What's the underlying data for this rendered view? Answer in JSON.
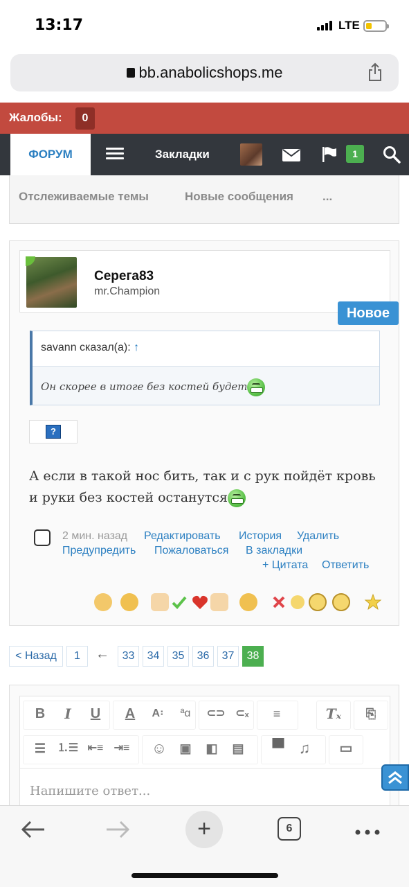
{
  "status_bar": {
    "time": "13:17",
    "network": "LTE"
  },
  "browser": {
    "url": "bb.anabolicshops.me",
    "tab_count": "6"
  },
  "complaints": {
    "label": "Жалобы:",
    "count": "0"
  },
  "nav": {
    "forum": "ФОРУМ",
    "bookmarks": "Закладки",
    "alerts_count": "1"
  },
  "subtabs": [
    "Отслеживаемые темы",
    "Новые сообщения",
    "..."
  ],
  "post": {
    "author": "Серега83",
    "author_title": "mr.Champion",
    "badge": "Новое",
    "quote_author": "savann сказал(а):",
    "quote_arrow": "↑",
    "quote_text": "Он скорее в итоге без костей будет",
    "image_placeholder": "?",
    "message": "А если в такой нос бить, так и с рук пойдёт кровь и руки без костей останутся",
    "time": "2 мин. назад",
    "actions": {
      "edit": "Редактировать",
      "history": "История",
      "delete": "Удалить",
      "warn": "Предупредить",
      "report": "Пожаловаться",
      "bookmark": "В закладки",
      "quote": "+ Цитата",
      "reply": "Ответить"
    }
  },
  "pagination": {
    "prev": "< Назад",
    "first": "1",
    "ellipsis_arrow": "←",
    "pages": [
      "33",
      "34",
      "35",
      "36",
      "37",
      "38"
    ],
    "current": "38"
  },
  "editor": {
    "placeholder": "Напишите ответ..."
  },
  "colors": {
    "complaints_bg": "#c24a3f",
    "nav_bg": "#33373d",
    "link": "#2b7fc1",
    "accent_green": "#4caf50",
    "new_badge": "#3a92d4"
  }
}
